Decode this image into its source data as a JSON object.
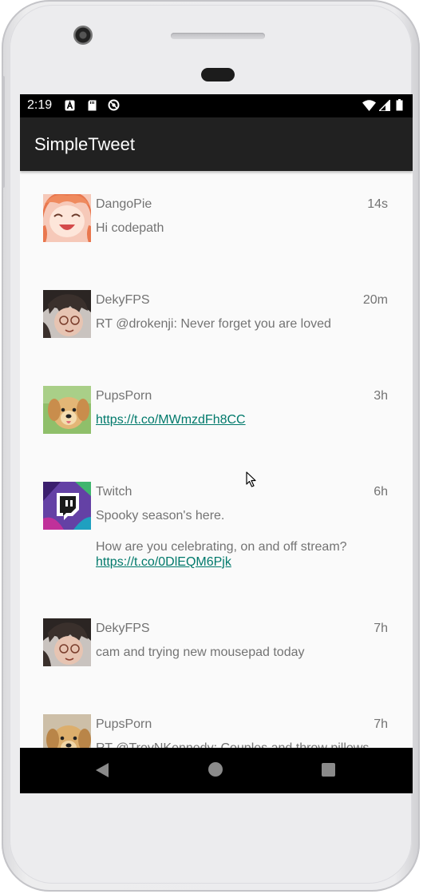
{
  "status_bar": {
    "time": "2:19",
    "icons": [
      "a-icon",
      "sd-card-icon",
      "sync-icon",
      "wifi-icon",
      "signal-icon",
      "battery-icon"
    ]
  },
  "app_bar": {
    "title": "SimpleTweet"
  },
  "tweets": [
    {
      "handle": "DangoPie",
      "time": "14s",
      "text": "Hi codepath",
      "link": "",
      "text2": ""
    },
    {
      "handle": "DekyFPS",
      "time": "20m",
      "text": "RT @drokenji: Never forget you are loved",
      "link": "",
      "text2": ""
    },
    {
      "handle": "PupsPorn",
      "time": "3h",
      "text": "",
      "link": "https://t.co/MWmzdFh8CC",
      "text2": ""
    },
    {
      "handle": "Twitch",
      "time": "6h",
      "text": "Spooky season's here.",
      "text2": "How are you celebrating, on and off stream?",
      "link": "https://t.co/0DlEQM6Pjk"
    },
    {
      "handle": "DekyFPS",
      "time": "7h",
      "text": "cam and trying new mousepad today",
      "link": "",
      "text2": ""
    },
    {
      "handle": "PupsPorn",
      "time": "7h",
      "text": "RT @TroyNKennedy: Couples and throw pillows",
      "link": "",
      "text2": ""
    }
  ],
  "nav_bar": {
    "buttons": [
      "back-icon",
      "home-icon",
      "recents-icon"
    ]
  },
  "colors": {
    "app_bar": "#212121",
    "link": "#00796b",
    "text": "#737373",
    "twitch": "#6441a5"
  }
}
